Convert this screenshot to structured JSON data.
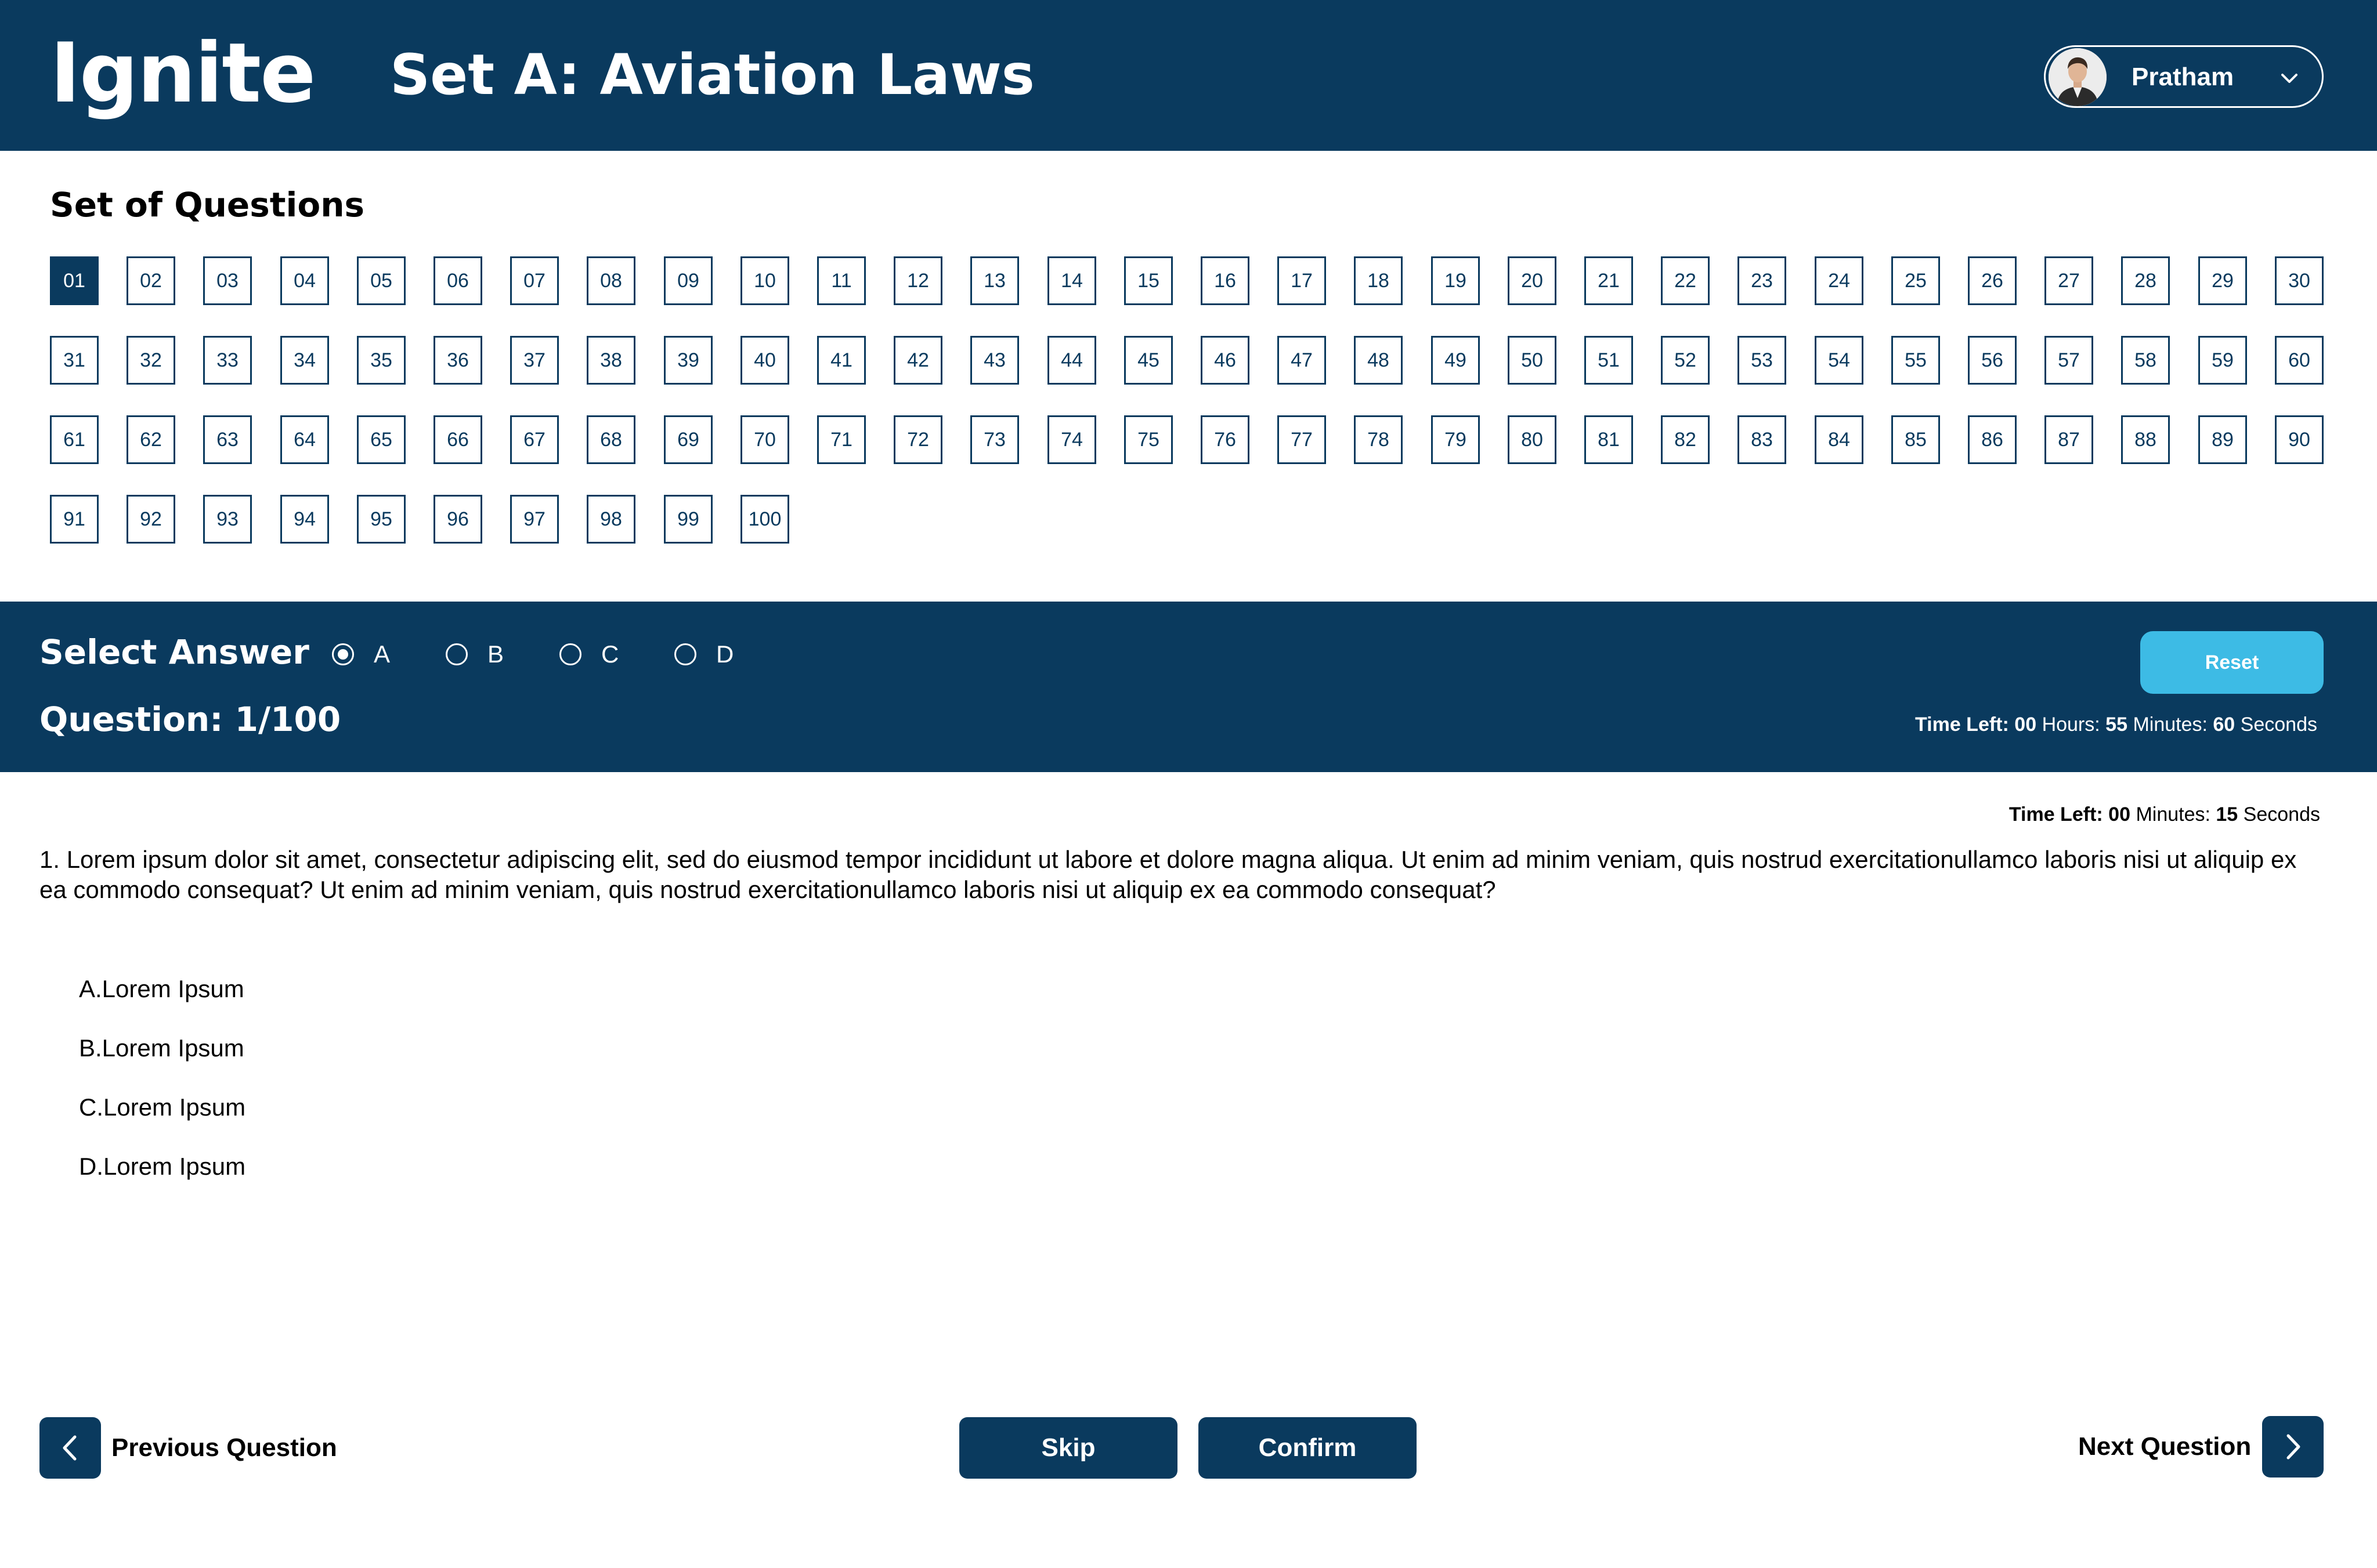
{
  "header": {
    "brand": "Ignite",
    "title": "Set A: Aviation Laws",
    "user_name": "Pratham"
  },
  "question_set": {
    "title": "Set of Questions",
    "active": "01",
    "numbers": [
      "01",
      "02",
      "03",
      "04",
      "05",
      "06",
      "07",
      "08",
      "09",
      "10",
      "11",
      "12",
      "13",
      "14",
      "15",
      "16",
      "17",
      "18",
      "19",
      "20",
      "21",
      "22",
      "23",
      "24",
      "25",
      "26",
      "27",
      "28",
      "29",
      "30",
      "31",
      "32",
      "33",
      "34",
      "35",
      "36",
      "37",
      "38",
      "39",
      "40",
      "41",
      "42",
      "43",
      "44",
      "45",
      "46",
      "47",
      "48",
      "49",
      "50",
      "51",
      "52",
      "53",
      "54",
      "55",
      "56",
      "57",
      "58",
      "59",
      "60",
      "61",
      "62",
      "63",
      "64",
      "65",
      "66",
      "67",
      "68",
      "69",
      "70",
      "71",
      "72",
      "73",
      "74",
      "75",
      "76",
      "77",
      "78",
      "79",
      "80",
      "81",
      "82",
      "83",
      "84",
      "85",
      "86",
      "87",
      "88",
      "89",
      "90",
      "91",
      "92",
      "93",
      "94",
      "95",
      "96",
      "97",
      "98",
      "99",
      "100"
    ]
  },
  "answer_bar": {
    "select_label": "Select Answer",
    "options": [
      {
        "label": "A",
        "checked": true
      },
      {
        "label": "B",
        "checked": false
      },
      {
        "label": "C",
        "checked": false
      },
      {
        "label": "D",
        "checked": false
      }
    ],
    "question_counter": "Question: 1/100",
    "reset_label": "Reset",
    "total_timer": {
      "prefix": "Time Left:",
      "hours": "00",
      "hours_unit": "Hours:",
      "minutes": "55",
      "minutes_unit": "Minutes:",
      "seconds": "60",
      "seconds_unit": "Seconds"
    }
  },
  "question": {
    "timer": {
      "prefix": "Time Left:",
      "minutes": "00",
      "minutes_unit": "Minutes:",
      "seconds": "15",
      "seconds_unit": "Seconds"
    },
    "text": "1. Lorem ipsum dolor sit amet, consectetur adipiscing elit, sed do eiusmod tempor incididunt ut labore et dolore magna aliqua. Ut enim ad minim veniam, quis nostrud exercitationullamco laboris nisi ut aliquip ex ea commodo consequat? Ut enim ad minim veniam, quis nostrud exercitationullamco laboris nisi ut aliquip ex ea commodo consequat?",
    "answers": [
      "A.Lorem Ipsum",
      "B.Lorem Ipsum",
      "C.Lorem Ipsum",
      "D.Lorem Ipsum"
    ]
  },
  "footer": {
    "previous_label": "Previous Question",
    "next_label": "Next Question",
    "skip_label": "Skip",
    "confirm_label": "Confirm"
  },
  "icons": {
    "avatar": "user-avatar",
    "dropdown": "chevron-down-icon",
    "previous": "chevron-left-icon",
    "next": "chevron-right-icon"
  },
  "colors": {
    "primary": "#0a3a5e",
    "accent": "#3dbbe5",
    "background": "#ffffff"
  }
}
